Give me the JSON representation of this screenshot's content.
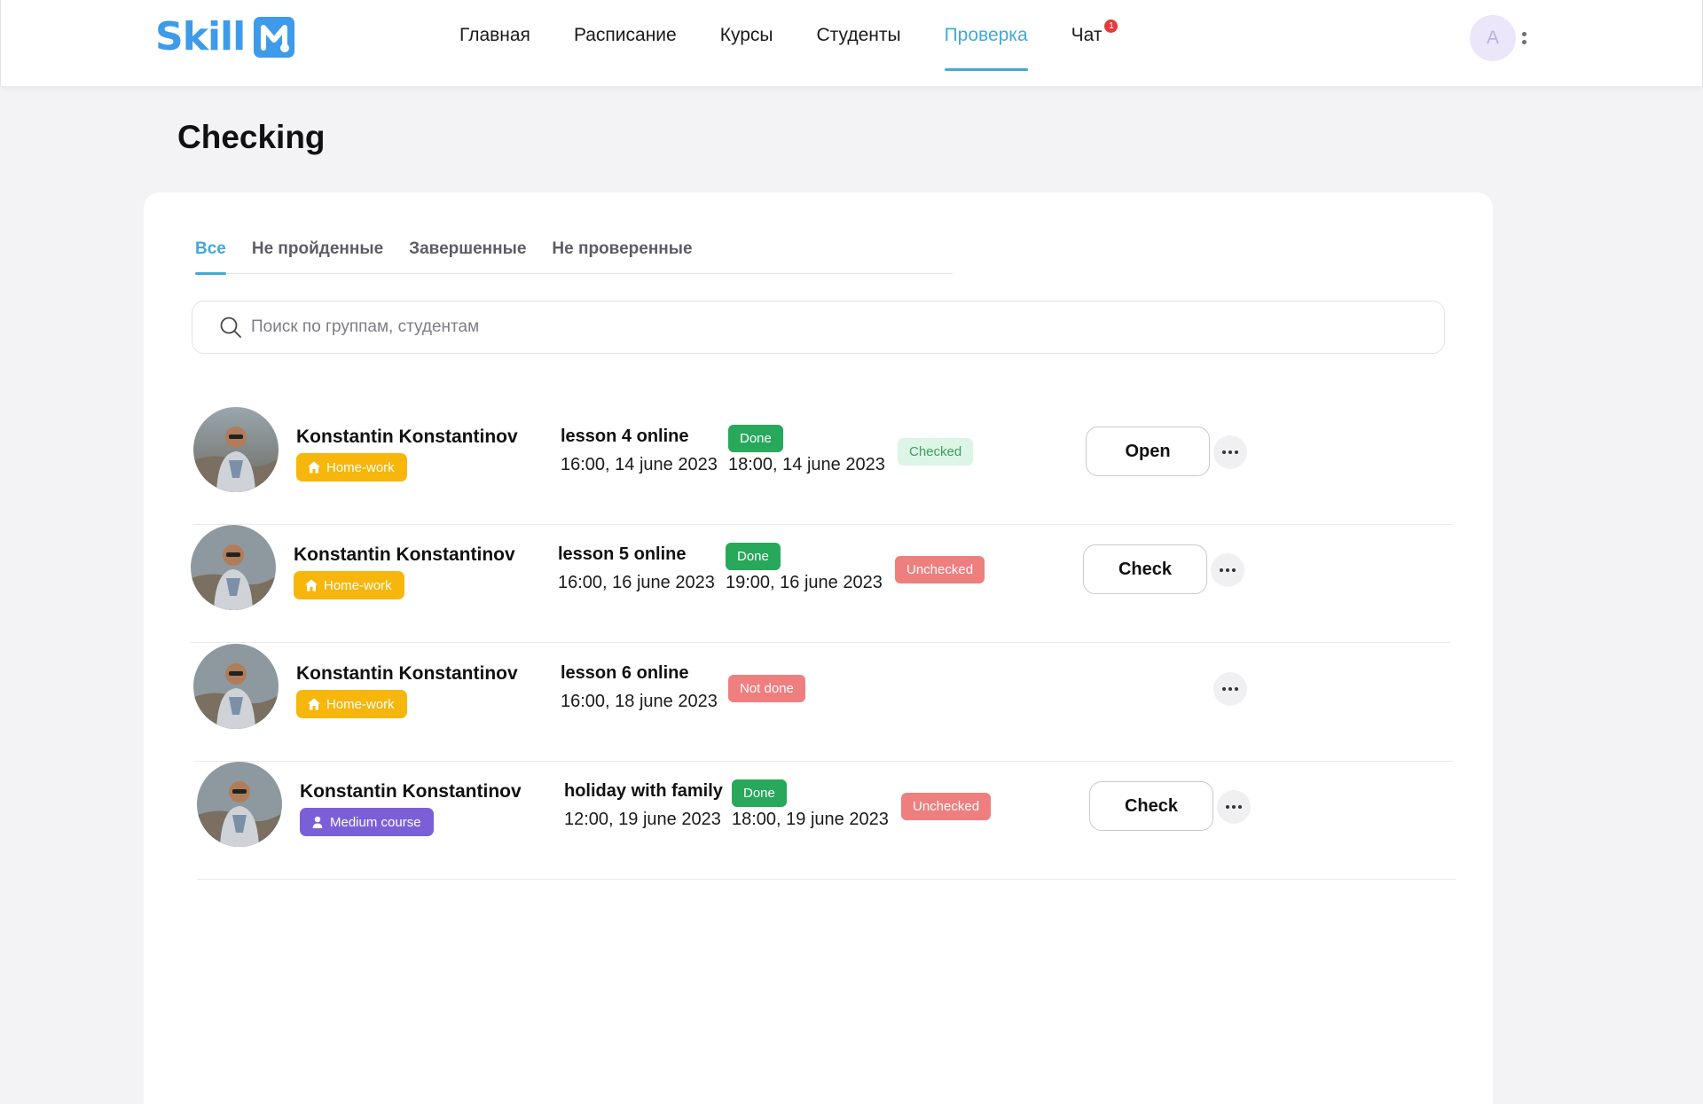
{
  "app": {
    "logo_text": "Skill",
    "brand_color": "#3d9be9",
    "accent_color": "#45a8d6"
  },
  "nav": {
    "items": [
      {
        "label": "Главная"
      },
      {
        "label": "Расписание"
      },
      {
        "label": "Курсы"
      },
      {
        "label": "Студенты"
      },
      {
        "label": "Проверка",
        "active": true
      },
      {
        "label": "Чат",
        "badge": "1"
      }
    ]
  },
  "user": {
    "avatar_initial": "A"
  },
  "page": {
    "title": "Checking"
  },
  "tabs": [
    {
      "label": "Все",
      "active": true
    },
    {
      "label": "Не пройденные"
    },
    {
      "label": "Завершенные"
    },
    {
      "label": "Не проверенные"
    }
  ],
  "search": {
    "placeholder": "Поиск по группам, студентам",
    "value": ""
  },
  "rows": [
    {
      "name": "Konstantin Konstantinov",
      "tag": "Home-work",
      "tag_type": "home-icon",
      "lesson": "lesson 4 online",
      "lesson_time": "16:00, 14 june 2023",
      "status": "Done",
      "done_time": "18:00, 14 june 2023",
      "check_status": "Checked",
      "action": "Open"
    },
    {
      "name": "Konstantin Konstantinov",
      "tag": "Home-work",
      "tag_type": "home-icon",
      "lesson": "lesson 5 online",
      "lesson_time": "16:00, 16 june 2023",
      "status": "Done",
      "done_time": "19:00, 16 june 2023",
      "check_status": "Unchecked",
      "action": "Check"
    },
    {
      "name": "Konstantin Konstantinov",
      "tag": "Home-work",
      "tag_type": "home-icon",
      "lesson": "lesson 6 online",
      "lesson_time": "16:00, 18 june 2023",
      "status": "Not done",
      "done_time": "",
      "check_status": "",
      "action": ""
    },
    {
      "name": "Konstantin Konstantinov",
      "tag": "Medium course",
      "tag_type": "graduate-icon",
      "lesson": "holiday with family",
      "lesson_time": "12:00, 19 june 2023",
      "status": "Done",
      "done_time": "18:00, 19 june 2023",
      "check_status": "Unchecked",
      "action": "Check"
    }
  ]
}
